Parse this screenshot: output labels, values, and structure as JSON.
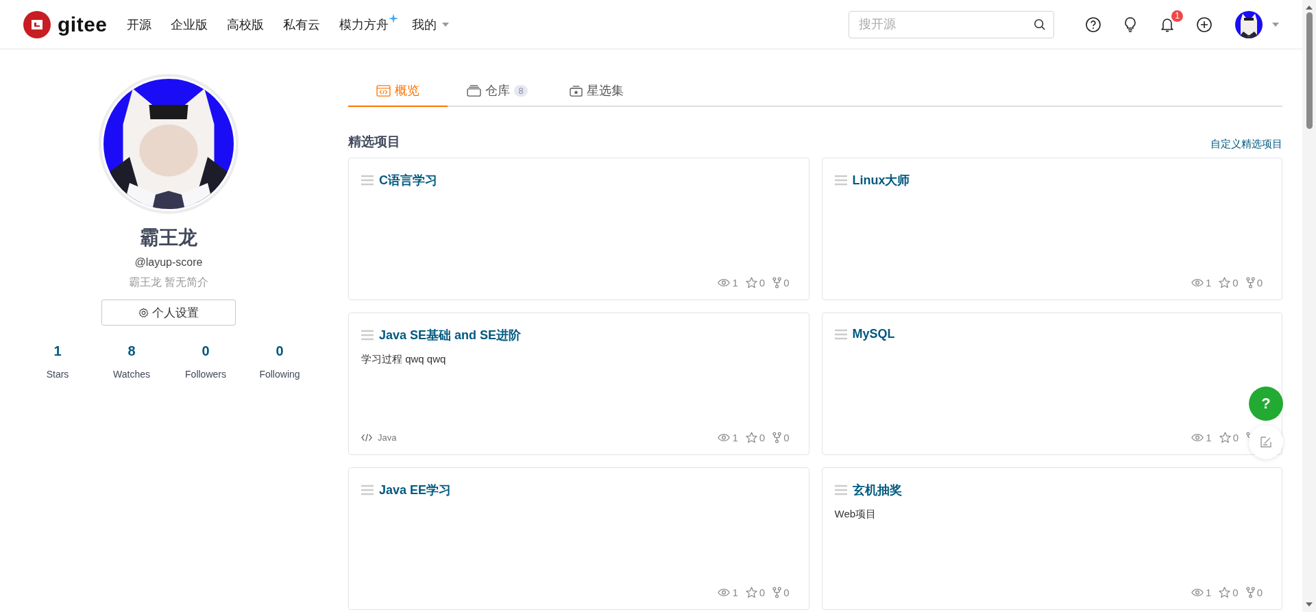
{
  "header": {
    "logo_text": "gitee",
    "nav": [
      {
        "label": "开源",
        "kind": "link"
      },
      {
        "label": "企业版",
        "kind": "link"
      },
      {
        "label": "高校版",
        "kind": "link"
      },
      {
        "label": "私有云",
        "kind": "link"
      },
      {
        "label": "模力方舟",
        "kind": "sparkle"
      },
      {
        "label": "我的",
        "kind": "dropdown"
      }
    ],
    "search": {
      "placeholder": "搜开源"
    },
    "notification_count": "1"
  },
  "profile": {
    "name": "霸王龙",
    "handle": "@layup-score",
    "bio": "霸王龙 暂无简介",
    "settings_button": "个人设置",
    "stats": [
      {
        "value": "1",
        "label": "Stars"
      },
      {
        "value": "8",
        "label": "Watches"
      },
      {
        "value": "0",
        "label": "Followers"
      },
      {
        "value": "0",
        "label": "Following"
      }
    ]
  },
  "tabs": [
    {
      "label": "概览",
      "selected": true
    },
    {
      "label": "仓库",
      "count": "8",
      "selected": false
    },
    {
      "label": "星选集",
      "selected": false
    }
  ],
  "help_button": "?",
  "featured": {
    "title": "精选项目",
    "customize_link": "自定义精选项目",
    "projects": [
      {
        "title": "C语言学习",
        "watches": "1",
        "stars": "0",
        "forks": "0"
      },
      {
        "title": "Linux大师",
        "watches": "1",
        "stars": "0",
        "forks": "0"
      },
      {
        "title": "Java SE基础 and SE进阶",
        "description": "学习过程 qwq qwq",
        "language": "Java",
        "watches": "1",
        "stars": "0",
        "forks": "0"
      },
      {
        "title": "MySQL",
        "watches": "1",
        "stars": "0"
      },
      {
        "title": "Java EE学习",
        "watches": "1",
        "stars": "0",
        "forks": "0"
      },
      {
        "title": "玄机抽奖",
        "description": "Web项目",
        "watches": "1",
        "stars": "0",
        "forks": "0"
      }
    ]
  }
}
